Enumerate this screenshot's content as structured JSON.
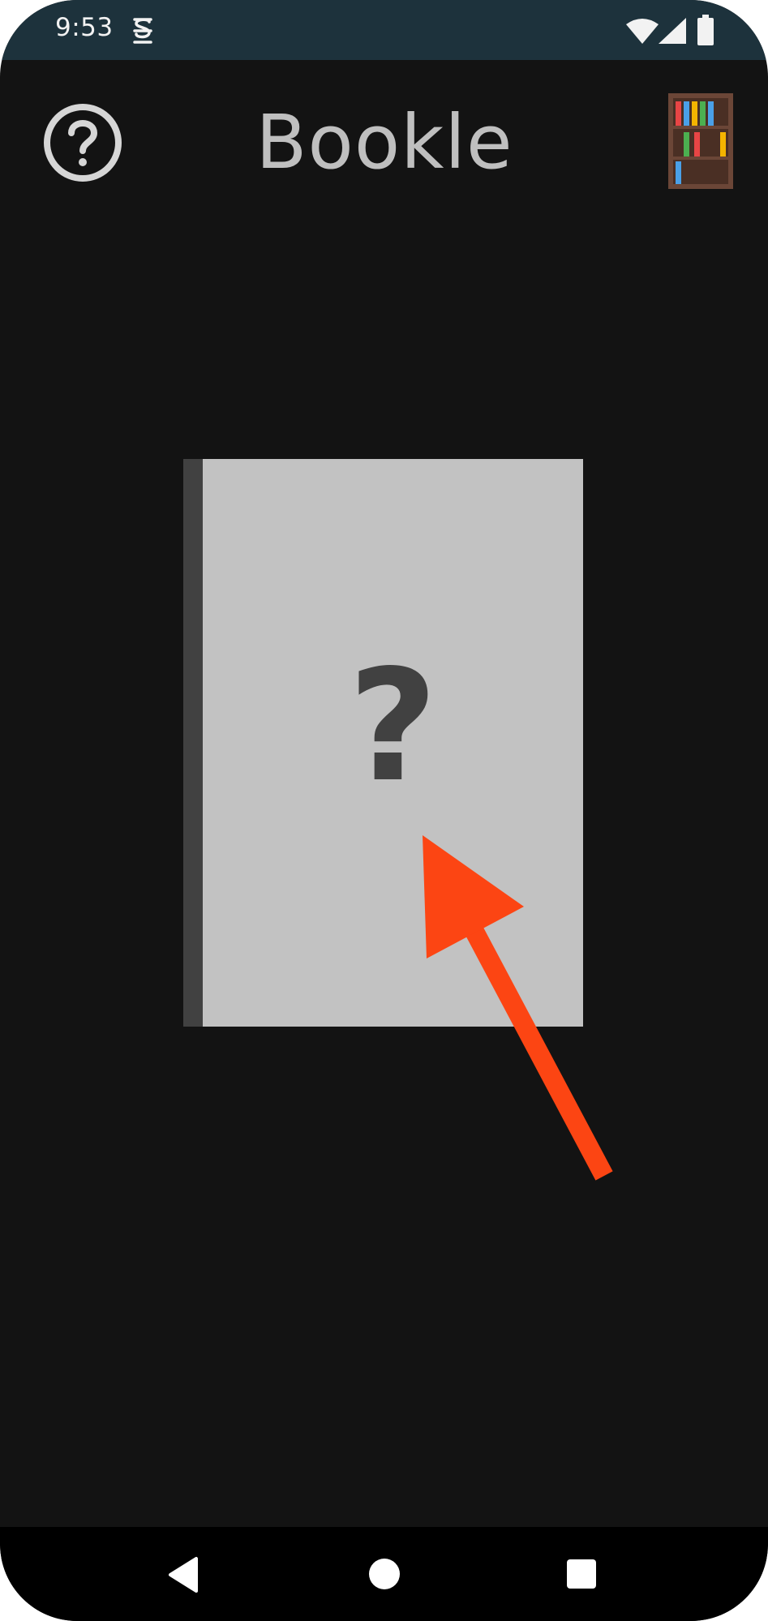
{
  "status_bar": {
    "time": "9:53",
    "icons": [
      "app-notification-icon",
      "wifi-icon",
      "signal-icon",
      "battery-icon"
    ]
  },
  "header": {
    "title": "Bookle",
    "help_icon": "help-circle-icon",
    "library_icon": "bookshelf-icon"
  },
  "book": {
    "cover_mark": "?",
    "cover_color": "#c2c2c2",
    "spine_color": "#414141"
  },
  "annotation": {
    "arrow_icon": "red-arrow-pointer",
    "color": "#fc4513"
  },
  "nav_bar": {
    "icons": [
      "back-icon",
      "home-icon",
      "recents-icon"
    ]
  },
  "theme": {
    "background": "#131313",
    "status_bar": "#1d323c",
    "title_color": "#bfbfbf"
  }
}
